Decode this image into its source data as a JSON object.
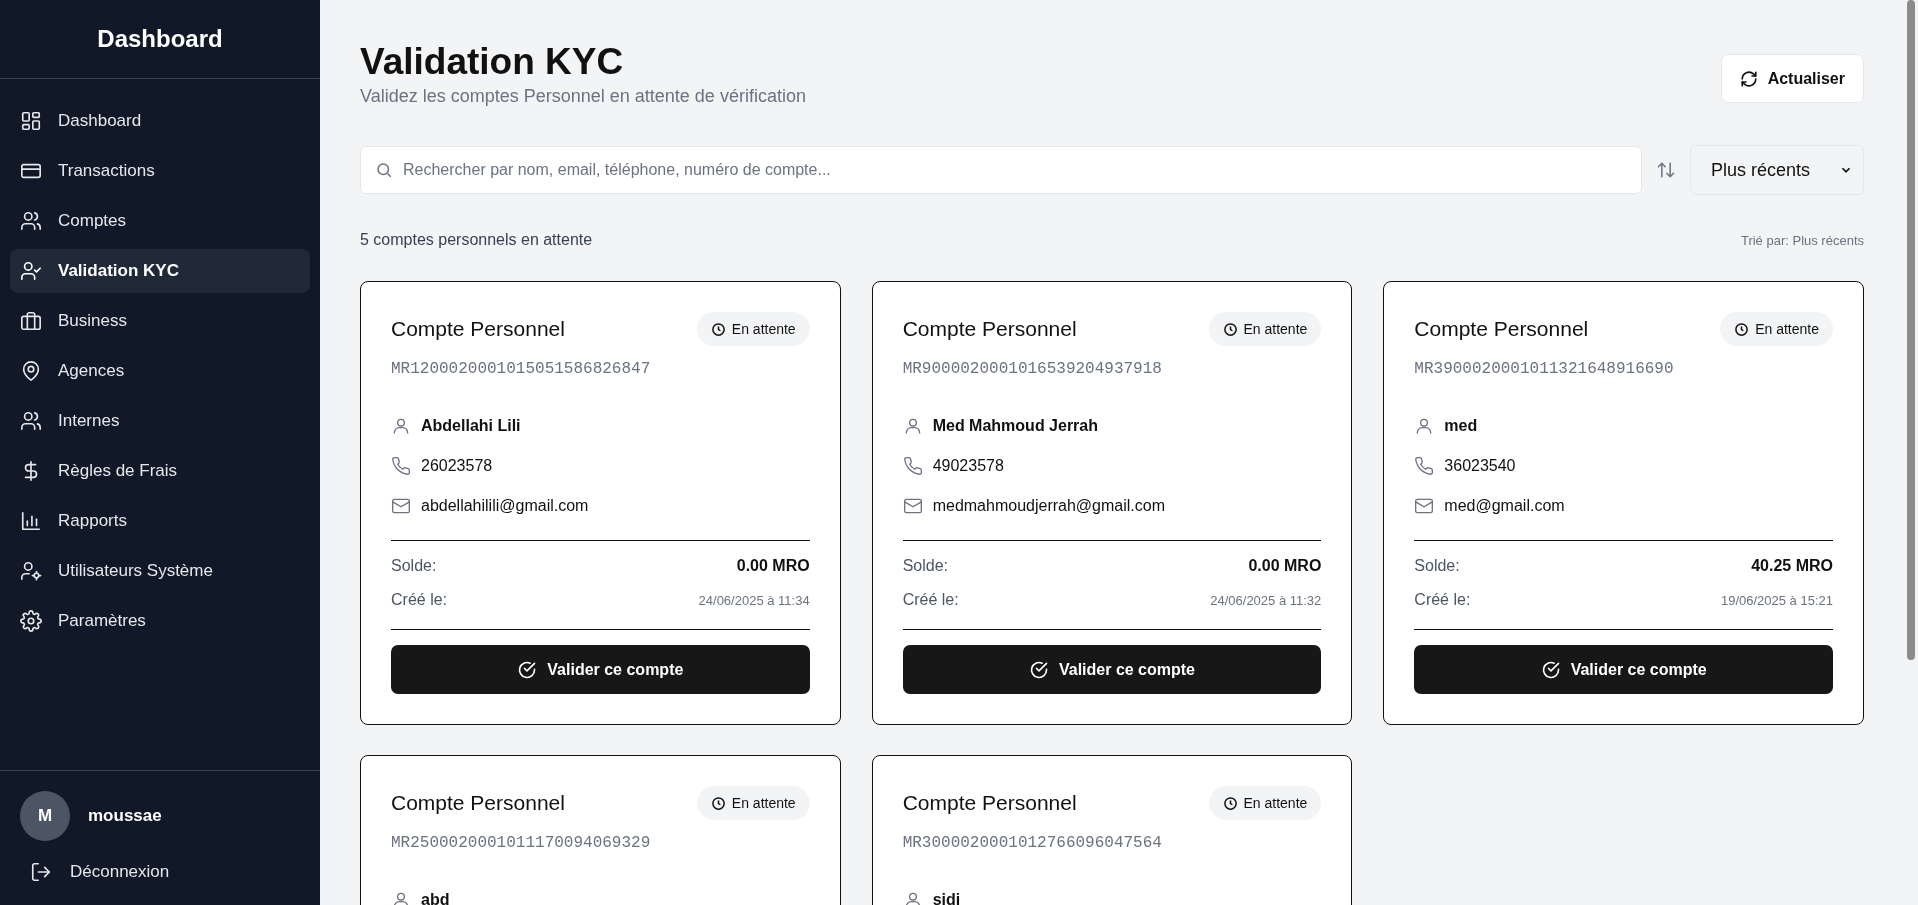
{
  "sidebar": {
    "title": "Dashboard",
    "items": [
      {
        "label": "Dashboard",
        "selected": false
      },
      {
        "label": "Transactions",
        "selected": false
      },
      {
        "label": "Comptes",
        "selected": false
      },
      {
        "label": "Validation KYC",
        "selected": true
      },
      {
        "label": "Business",
        "selected": false
      },
      {
        "label": "Agences",
        "selected": false
      },
      {
        "label": "Internes",
        "selected": false
      },
      {
        "label": "Règles de Frais",
        "selected": false
      },
      {
        "label": "Rapports",
        "selected": false
      },
      {
        "label": "Utilisateurs Système",
        "selected": false
      },
      {
        "label": "Paramètres",
        "selected": false
      }
    ],
    "user": {
      "initial": "M",
      "name": "moussae"
    },
    "logout": "Déconnexion"
  },
  "header": {
    "title": "Validation KYC",
    "subtitle": "Validez les comptes Personnel en attente de vérification",
    "refresh_button": "Actualiser"
  },
  "search": {
    "placeholder": "Rechercher par nom, email, téléphone, numéro de compte..."
  },
  "sort": {
    "value": "Plus récents"
  },
  "summary": {
    "count": "5 comptes personnels en attente",
    "sorted_by": "Trié par: Plus récents"
  },
  "cards": [
    {
      "title": "Compte Personnel",
      "status": "En attente",
      "account": "MR1200020001015051586826847",
      "name": "Abdellahi Lili",
      "phone": "26023578",
      "email": "abdellahilili@gmail.com",
      "balance_label": "Solde:",
      "balance": "0.00 MRO",
      "created_label": "Créé le:",
      "created": "24/06/2025 à 11:34",
      "button": "Valider ce compte"
    },
    {
      "title": "Compte Personnel",
      "status": "En attente",
      "account": "MR9000020001016539204937918",
      "name": "Med Mahmoud Jerrah",
      "phone": "49023578",
      "email": "medmahmoudjerrah@gmail.com",
      "balance_label": "Solde:",
      "balance": "0.00 MRO",
      "created_label": "Créé le:",
      "created": "24/06/2025 à 11:32",
      "button": "Valider ce compte"
    },
    {
      "title": "Compte Personnel",
      "status": "En attente",
      "account": "MR3900020001011321648916690",
      "name": "med",
      "phone": "36023540",
      "email": "med@gmail.com",
      "balance_label": "Solde:",
      "balance": "40.25 MRO",
      "created_label": "Créé le:",
      "created": "19/06/2025 à 15:21",
      "button": "Valider ce compte"
    },
    {
      "title": "Compte Personnel",
      "status": "En attente",
      "account": "MR2500020001011170094069329",
      "name": "abd"
    },
    {
      "title": "Compte Personnel",
      "status": "En attente",
      "account": "MR3000020001012766096047564",
      "name": "sidi"
    }
  ]
}
